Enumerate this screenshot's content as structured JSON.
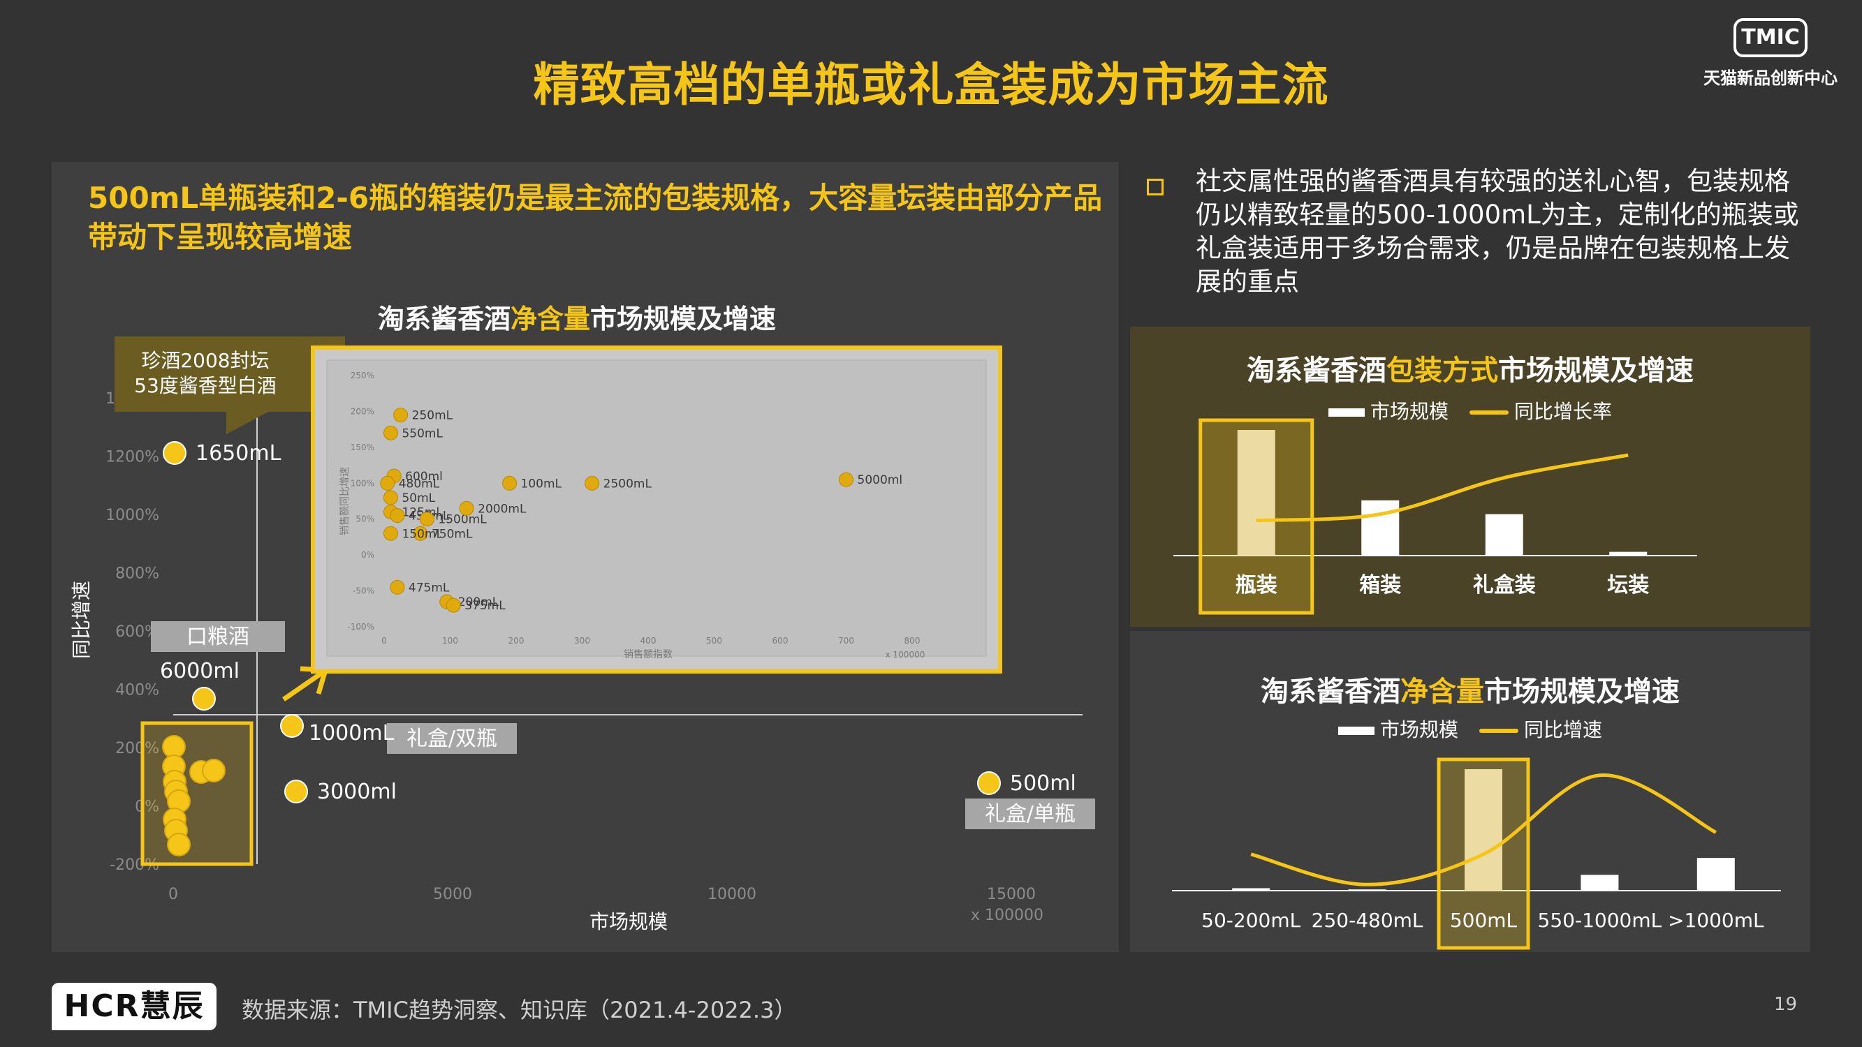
{
  "title": "精致高档的单瓶或礼盒装成为市场主流",
  "brand": {
    "logo_text": "TMIC",
    "subtitle": "天猫新品创新中心"
  },
  "left_headline": "500mL单瓶装和2-6瓶的箱装仍是最主流的包装规格，大容量坛装由部分产品带动下呈现较高增速",
  "bullet_text": "社交属性强的酱香酒具有较强的送礼心智，包装规格仍以精致轻量的500-1000mL为主，定制化的瓶装或礼盒装适用于多场合需求，仍是品牌在包装规格上发展的重点",
  "footer": {
    "logo_text": "HCR慧辰",
    "source": "数据来源：TMIC趋势洞察、知识库（2021.4-2022.3）",
    "page_number": "19"
  },
  "colors": {
    "accent": "#f5c518",
    "background": "#333333",
    "panel": "#3f3f3f",
    "panel_highlight": "#4a4327",
    "inset_bg": "#c9c9c9"
  },
  "chart_data": [
    {
      "type": "scatter",
      "title_parts": [
        "淘系酱香酒",
        "净含量",
        "市场规模及增速"
      ],
      "xlabel": "市场规模",
      "ylabel": "同比增速",
      "x_unit": "x 100000",
      "xlim": [
        0,
        15000
      ],
      "ylim": [
        -200,
        1400
      ],
      "x_ticks": [
        "0",
        "5000",
        "10000",
        "15000"
      ],
      "y_ticks": [
        "-200%",
        "0%",
        "200%",
        "400%",
        "600%",
        "800%",
        "1000%",
        "1200%",
        "1400%"
      ],
      "points": [
        {
          "label": "1650mL",
          "x": 0,
          "y": 1150
        },
        {
          "label": "6000ml",
          "x": 100,
          "y": 330
        },
        {
          "label": "1000mL",
          "x": 400,
          "y": 250
        },
        {
          "label": "3000ml",
          "x": 400,
          "y": 35
        },
        {
          "label": "500ml",
          "x": 13500,
          "y": 65
        },
        {
          "label": "",
          "x": 0,
          "y": 190
        },
        {
          "label": "",
          "x": 0,
          "y": 140
        },
        {
          "label": "",
          "x": 0,
          "y": 100
        },
        {
          "label": "",
          "x": 50,
          "y": 60
        },
        {
          "label": "",
          "x": 100,
          "y": 30
        },
        {
          "label": "",
          "x": 0,
          "y": -10
        },
        {
          "label": "",
          "x": 0,
          "y": -50
        },
        {
          "label": "",
          "x": 50,
          "y": -80
        },
        {
          "label": "",
          "x": 300,
          "y": 100
        },
        {
          "label": "",
          "x": 700,
          "y": 110
        }
      ],
      "callouts": {
        "top": "珍酒2008封坛\n53度酱香型白酒",
        "koulian": "口粮酒",
        "gift_double": "礼盒/双瓶",
        "gift_single": "礼盒/单瓶"
      }
    },
    {
      "type": "scatter",
      "title": "",
      "xlabel": "销售额指数",
      "ylabel": "销售额同比增速",
      "x_unit": "x 100000",
      "xlim": [
        0,
        800
      ],
      "ylim": [
        -100,
        250
      ],
      "x_ticks": [
        "0",
        "100",
        "200",
        "300",
        "400",
        "500",
        "600",
        "700",
        "800"
      ],
      "y_ticks": [
        "-100%",
        "-50%",
        "0%",
        "50%",
        "100%",
        "150%",
        "200%",
        "250%"
      ],
      "points": [
        {
          "label": "250mL",
          "x": 25,
          "y": 195
        },
        {
          "label": "550mL",
          "x": 10,
          "y": 170
        },
        {
          "label": "600ml",
          "x": 15,
          "y": 110
        },
        {
          "label": "480mL",
          "x": 5,
          "y": 100
        },
        {
          "label": "50mL",
          "x": 10,
          "y": 80
        },
        {
          "label": "125ml",
          "x": 10,
          "y": 60
        },
        {
          "label": "450mL",
          "x": 20,
          "y": 55
        },
        {
          "label": "1500mL",
          "x": 65,
          "y": 50
        },
        {
          "label": "2000mL",
          "x": 125,
          "y": 65
        },
        {
          "label": "750mL",
          "x": 55,
          "y": 30
        },
        {
          "label": "150mL",
          "x": 10,
          "y": 30
        },
        {
          "label": "100mL",
          "x": 190,
          "y": 100
        },
        {
          "label": "2500mL",
          "x": 315,
          "y": 100
        },
        {
          "label": "5000ml",
          "x": 700,
          "y": 105
        },
        {
          "label": "475mL",
          "x": 20,
          "y": -45
        },
        {
          "label": "200mL",
          "x": 95,
          "y": -65
        },
        {
          "label": "375mL",
          "x": 105,
          "y": -70
        }
      ]
    },
    {
      "type": "bar",
      "title_parts": [
        "淘系酱香酒",
        "包装方式",
        "市场规模及增速"
      ],
      "legend": [
        "市场规模",
        "同比增长率"
      ],
      "categories": [
        "瓶装",
        "箱装",
        "礼盒装",
        "坛装"
      ],
      "values": [
        100,
        44,
        33,
        3
      ],
      "growth": [
        28,
        33,
        62,
        80
      ],
      "highlight": "瓶装"
    },
    {
      "type": "bar",
      "title_parts": [
        "淘系酱香酒",
        "净含量",
        "市场规模及增速"
      ],
      "legend": [
        "市场规模",
        "同比增速"
      ],
      "categories": [
        "50-200mL",
        "250-480mL",
        "500mL",
        "550-1000mL",
        ">1000mL"
      ],
      "values": [
        2,
        1,
        100,
        13,
        27
      ],
      "growth": [
        30,
        5,
        30,
        95,
        48
      ],
      "highlight": "500mL"
    }
  ]
}
